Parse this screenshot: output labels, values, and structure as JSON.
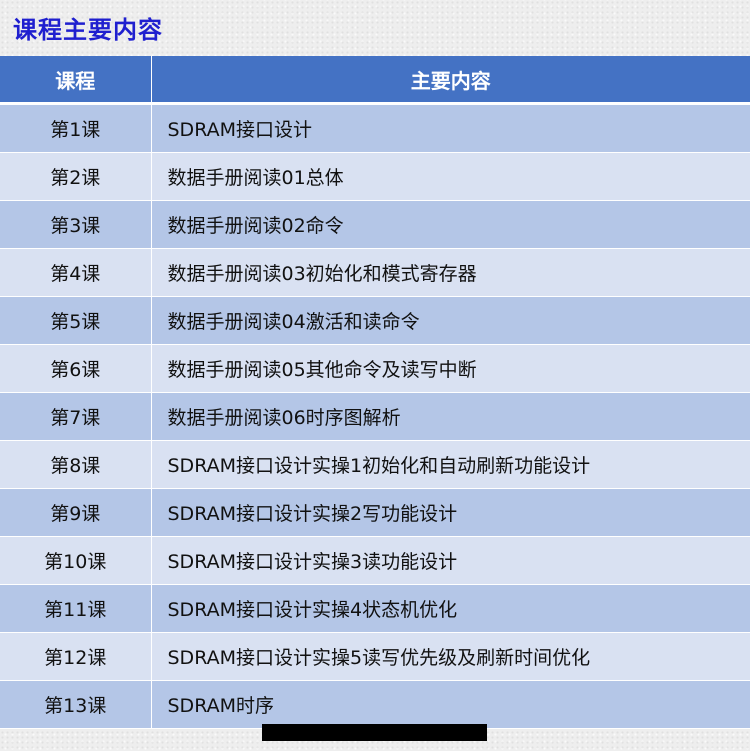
{
  "page_title": "课程主要内容",
  "table": {
    "headers": [
      "课程",
      "主要内容"
    ],
    "rows": [
      {
        "lesson": "第1课",
        "content": "SDRAM接口设计"
      },
      {
        "lesson": "第2课",
        "content": "数据手册阅读01总体"
      },
      {
        "lesson": "第3课",
        "content": "数据手册阅读02命令"
      },
      {
        "lesson": "第4课",
        "content": "数据手册阅读03初始化和模式寄存器"
      },
      {
        "lesson": "第5课",
        "content": "数据手册阅读04激活和读命令"
      },
      {
        "lesson": "第6课",
        "content": "数据手册阅读05其他命令及读写中断"
      },
      {
        "lesson": "第7课",
        "content": "数据手册阅读06时序图解析"
      },
      {
        "lesson": "第8课",
        "content": "SDRAM接口设计实操1初始化和自动刷新功能设计"
      },
      {
        "lesson": "第9课",
        "content": "SDRAM接口设计实操2写功能设计"
      },
      {
        "lesson": "第10课",
        "content": "SDRAM接口设计实操3读功能设计"
      },
      {
        "lesson": "第11课",
        "content": "SDRAM接口设计实操4状态机优化"
      },
      {
        "lesson": "第12课",
        "content": "SDRAM接口设计实操5读写优先级及刷新时间优化"
      },
      {
        "lesson": "第13课",
        "content": "SDRAM时序"
      }
    ]
  },
  "colors": {
    "title": "#1f1fcf",
    "header_bg": "#4472c4",
    "row_odd": "#b4c6e7",
    "row_even": "#d9e1f2"
  }
}
